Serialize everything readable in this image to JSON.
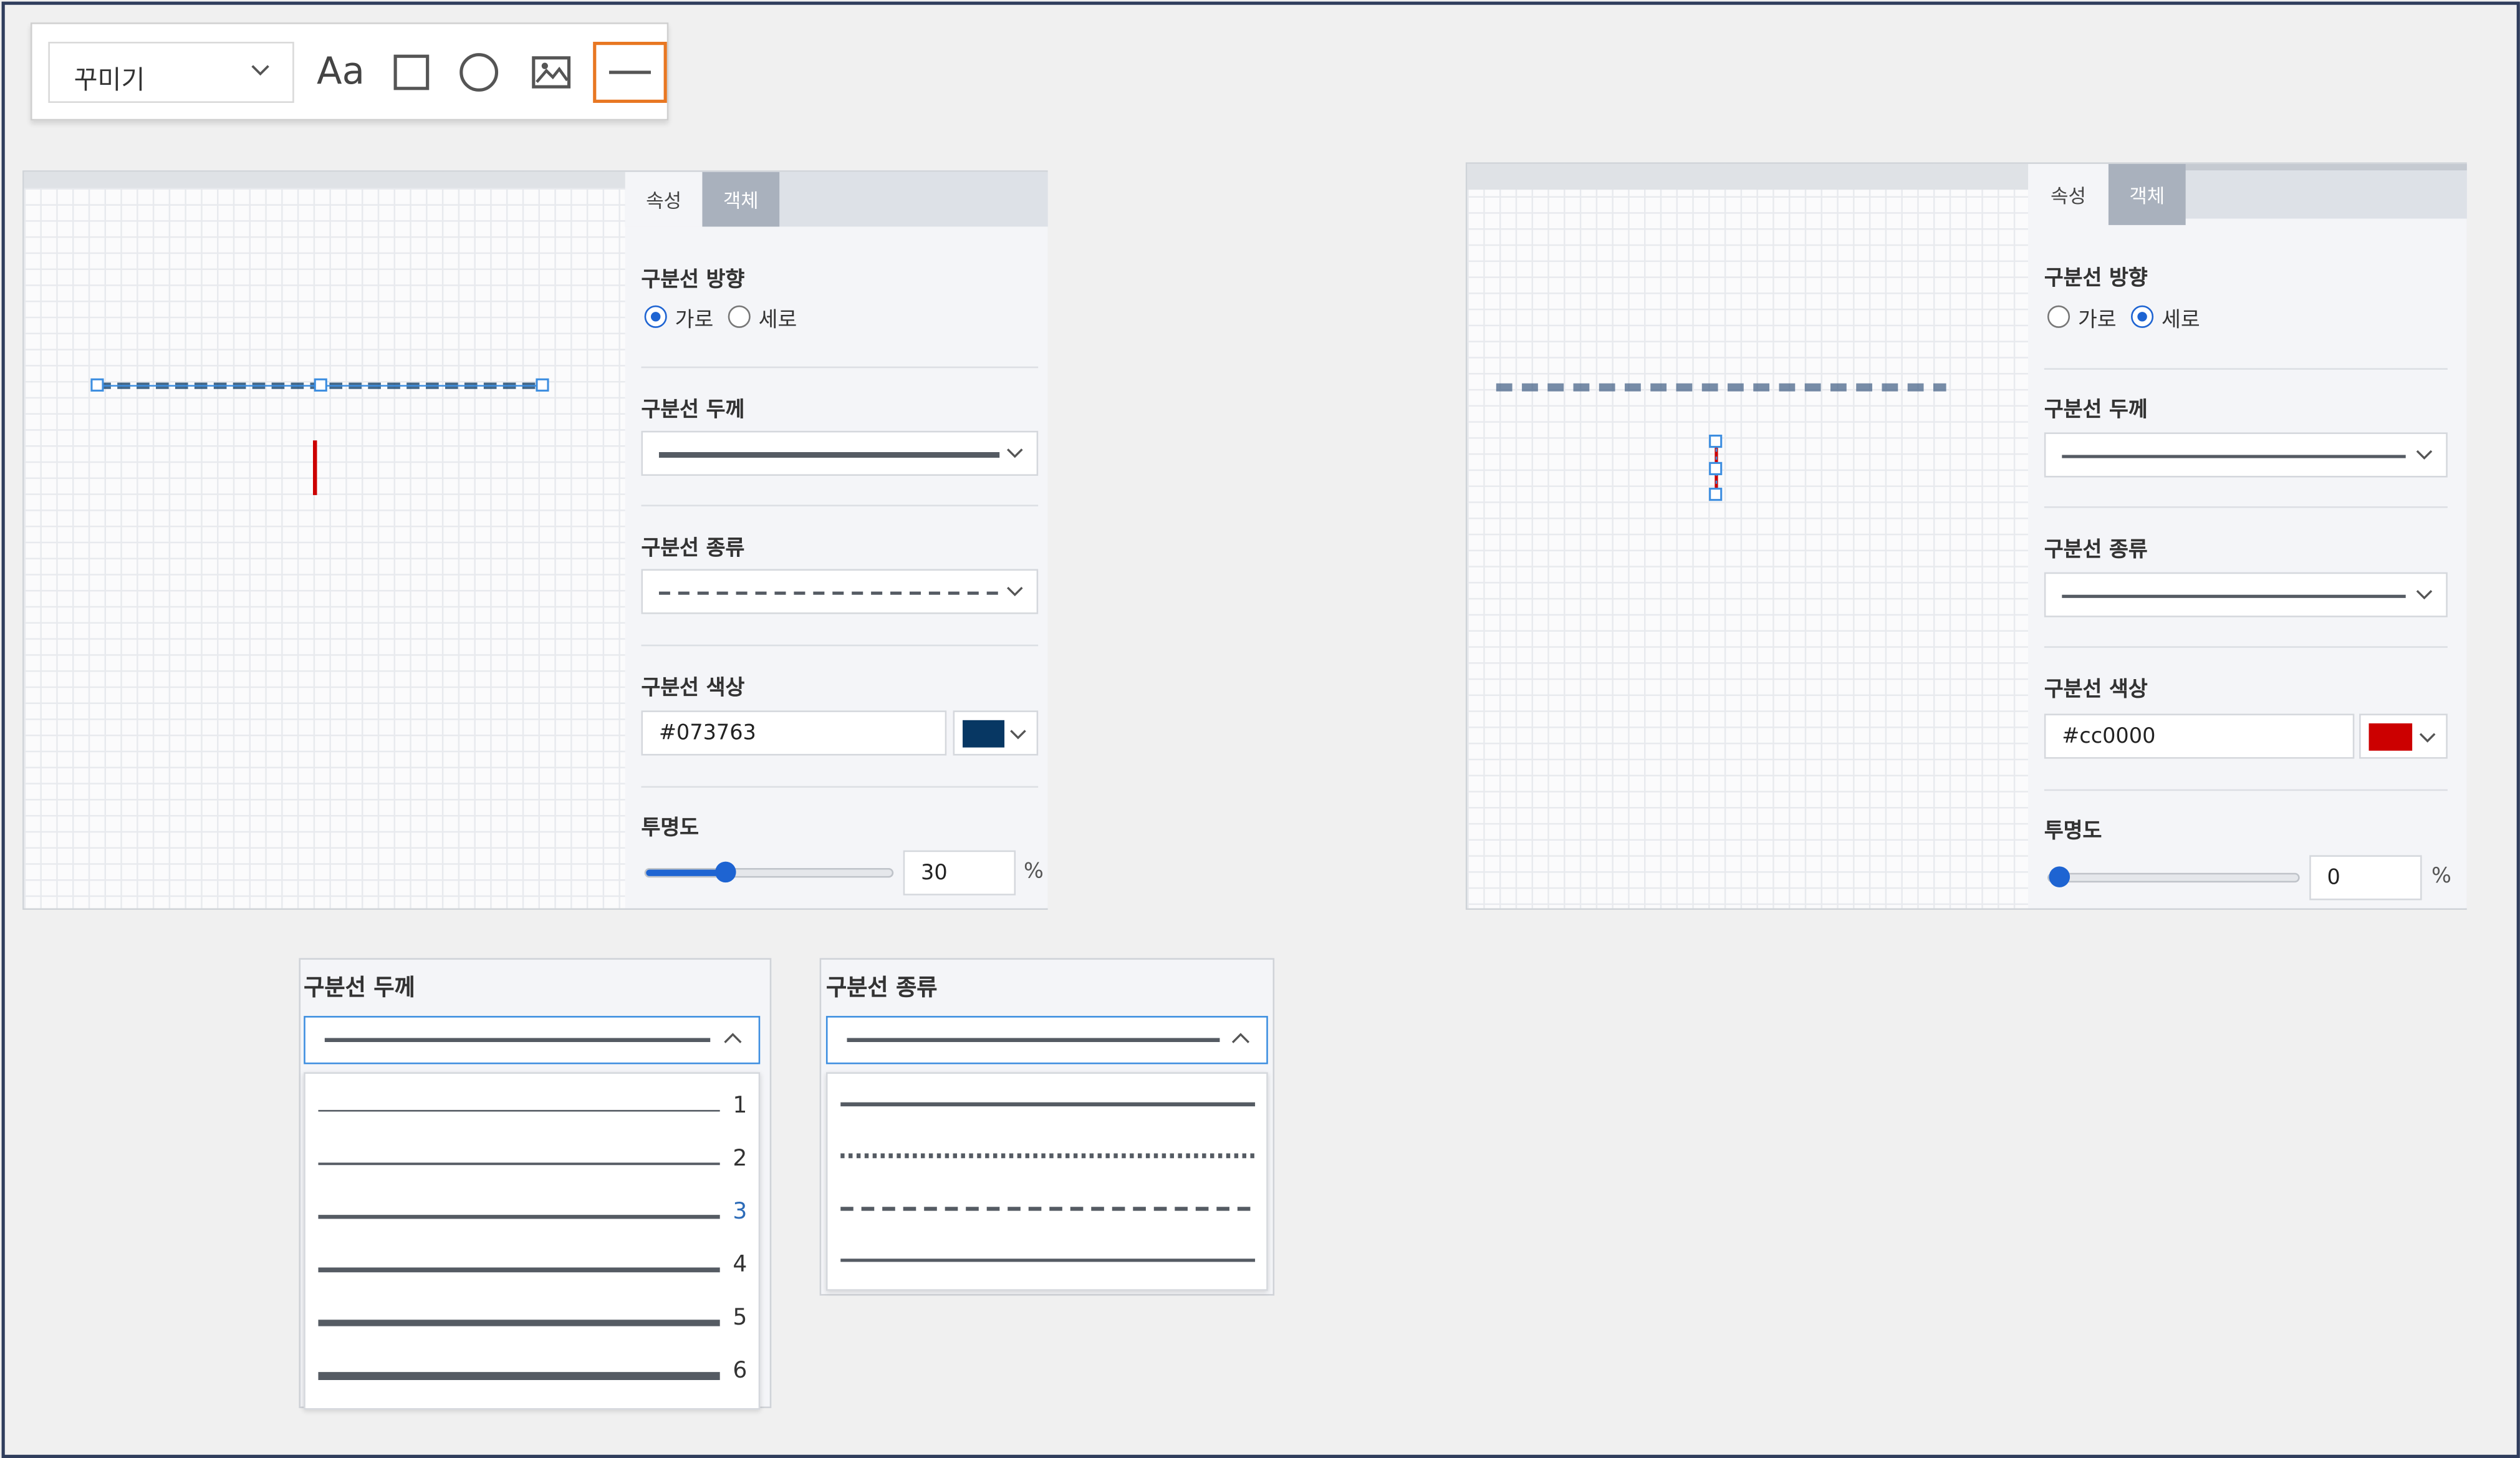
{
  "toolbar": {
    "select_label": "꾸미기",
    "text_tool_label": "Aa",
    "tools": [
      "text-tool",
      "rectangle-tool",
      "circle-tool",
      "image-tool",
      "line-tool"
    ],
    "active_tool": "line-tool",
    "active_color": "#e87722"
  },
  "panel_left": {
    "tabs": [
      "속성",
      "객체"
    ],
    "active_tab": "속성",
    "direction_label": "구분선 방향",
    "direction_options": [
      "가로",
      "세로"
    ],
    "direction_selected": "가로",
    "thickness_label": "구분선 두께",
    "type_label": "구분선 종류",
    "type_selected": "dashed",
    "color_label": "구분선 색상",
    "color_value": "#073763",
    "opacity_label": "투명도",
    "opacity_value": "30",
    "opacity_unit": "%"
  },
  "panel_right": {
    "tabs": [
      "속성",
      "객체"
    ],
    "active_tab": "속성",
    "direction_label": "구분선 방향",
    "direction_options": [
      "가로",
      "세로"
    ],
    "direction_selected": "세로",
    "thickness_label": "구분선 두께",
    "type_label": "구분선 종류",
    "type_selected": "solid",
    "color_label": "구분선 색상",
    "color_value": "#cc0000",
    "opacity_label": "투명도",
    "opacity_value": "0",
    "opacity_unit": "%"
  },
  "thickness_dropdown": {
    "label": "구분선 두께",
    "options": [
      "1",
      "2",
      "3",
      "4",
      "5",
      "6"
    ],
    "selected": "3"
  },
  "type_dropdown": {
    "label": "구분선 종류",
    "options": [
      "solid",
      "dotted",
      "dashed",
      "solid"
    ]
  },
  "colors": {
    "selection": "#3d8ee0",
    "radio_on": "#1e64d2",
    "left_swatch": "#073763",
    "right_swatch": "#cc0000"
  }
}
